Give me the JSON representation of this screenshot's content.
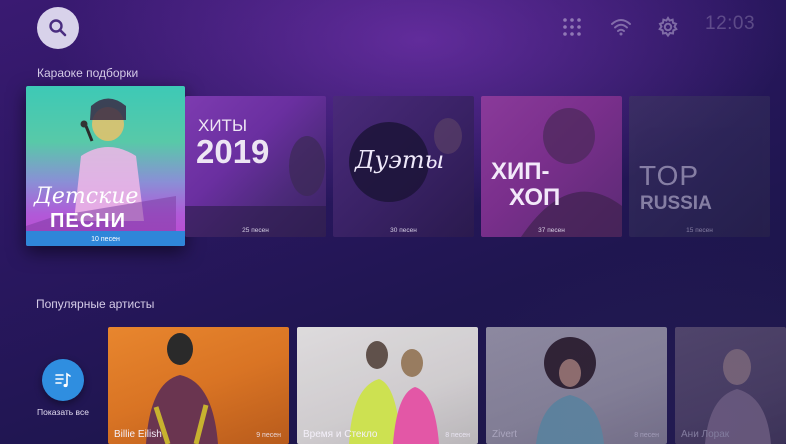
{
  "topbar": {
    "search_icon": "search-icon",
    "apps_icon": "grid-icon",
    "wifi_icon": "wifi-icon",
    "settings_icon": "gear-icon",
    "clock": "12:03"
  },
  "karaoke": {
    "title": "Караоке подборки",
    "cards": [
      {
        "label_line1": "Детские",
        "label_line2": "песни",
        "count": "10 песен"
      },
      {
        "label_line1": "ХИТЫ",
        "label_line2": "2019",
        "count": "25 песен"
      },
      {
        "label_line1": "Дуэты",
        "count": "30 песен"
      },
      {
        "label_line1": "ХИП-",
        "label_line2": "ХОП",
        "count": "37 песен"
      },
      {
        "label_line1": "TOP",
        "label_line2": "RUSSIA",
        "count": "15 песен"
      }
    ]
  },
  "artists": {
    "title": "Популярные артисты",
    "show_all_label": "Показать все",
    "show_all_icon": "playlist-music-icon",
    "cards": [
      {
        "name": "Billie Eilish",
        "count": "9 песен"
      },
      {
        "name": "Время и Стекло",
        "count": "8 песен"
      },
      {
        "name": "Zivert",
        "count": "8 песен"
      },
      {
        "name": "Ани Лорак",
        "count": ""
      }
    ]
  },
  "colors": {
    "accent": "#2f86d9",
    "background": "#2a1760"
  }
}
